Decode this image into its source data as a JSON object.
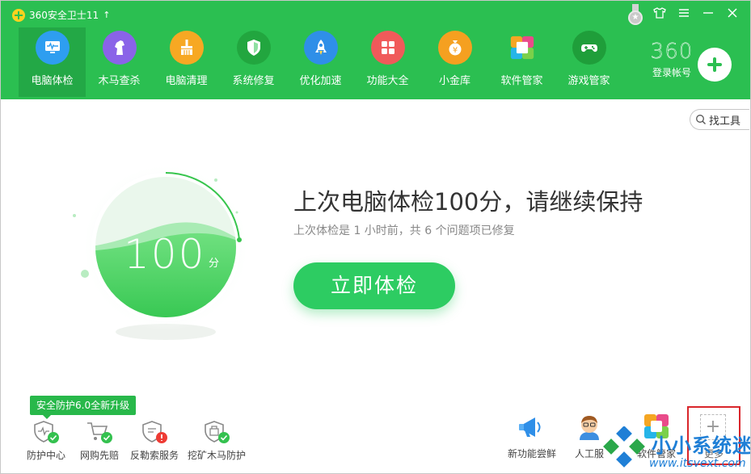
{
  "app": {
    "title": "360安全卫士11",
    "update_arrow": "↑"
  },
  "window_controls": {
    "medal": "★",
    "skin": "skin-icon",
    "menu": "menu-icon",
    "minimize": "minimize-icon",
    "close": "close-icon"
  },
  "nav": [
    {
      "label": "电脑体检",
      "icon": "computer-check-icon",
      "color": "#2e9ef0",
      "active": true
    },
    {
      "label": "木马查杀",
      "icon": "horse-icon",
      "color": "#8a63e8"
    },
    {
      "label": "电脑清理",
      "icon": "broom-icon",
      "color": "#f7a823"
    },
    {
      "label": "系统修复",
      "icon": "shield-icon",
      "color": "#22a63f"
    },
    {
      "label": "优化加速",
      "icon": "rocket-icon",
      "color": "#2f8fe8"
    },
    {
      "label": "功能大全",
      "icon": "grid-icon",
      "color": "#f05a5a"
    },
    {
      "label": "小金库",
      "icon": "money-bag-icon",
      "color": "#f5a020"
    },
    {
      "label": "软件管家",
      "icon": "software-icon",
      "color": "#ffffff"
    },
    {
      "label": "游戏管家",
      "icon": "gamepad-icon",
      "color": "#1f9e3a"
    }
  ],
  "account": {
    "brand": "360",
    "login_label": "登录帐号"
  },
  "search": {
    "label": "找工具"
  },
  "score": {
    "value": "100",
    "unit": "分"
  },
  "main": {
    "headline": "上次电脑体检100分，请继续保持",
    "subline": "上次体检是 1 小时前，共 6 个问题项已修复",
    "check_button": "立即体检"
  },
  "protection_tip": "安全防护6.0全新升级",
  "protection_items": [
    {
      "label": "防护中心",
      "icon": "protection-center-icon"
    },
    {
      "label": "网购先赔",
      "icon": "shopping-cart-icon"
    },
    {
      "label": "反勒索服务",
      "icon": "anti-ransom-icon"
    },
    {
      "label": "挖矿木马防护",
      "icon": "mining-protection-icon"
    }
  ],
  "tools": [
    {
      "label": "新功能尝鲜",
      "icon": "megaphone-icon"
    },
    {
      "label": "人工服",
      "icon": "support-person-icon"
    },
    {
      "label": "软件管家",
      "icon": "software-manager-icon"
    }
  ],
  "more": {
    "label": "更多",
    "plus": "+"
  },
  "watermark": {
    "text": "小小系统迷",
    "url": "www.itsvext.com"
  },
  "colors": {
    "primary": "#2bbf51",
    "active_nav": "#23a846",
    "button": "#2dcc62",
    "highlight": "#d9262b"
  }
}
